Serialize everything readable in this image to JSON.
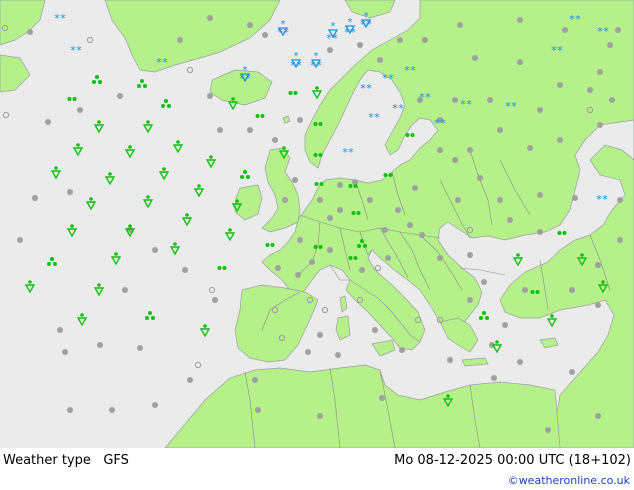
{
  "footer": {
    "product": "Weather type",
    "model": "GFS",
    "valid_time": "Mo 08-12-2025 00:00 UTC (18+102)",
    "credit": "©weatheronline.co.uk"
  },
  "colors": {
    "sea": "#ebebeb",
    "land": "#b5f08a",
    "border": "#8a8a8a",
    "rain": "#10c010",
    "snow": "#1a8fe0",
    "cloud": "#a0a0a0"
  },
  "legend_symbols": [
    "rain-shower-icon",
    "drizzle-icon",
    "snow-icon",
    "cloud-dot-icon",
    "thunder-icon"
  ]
}
